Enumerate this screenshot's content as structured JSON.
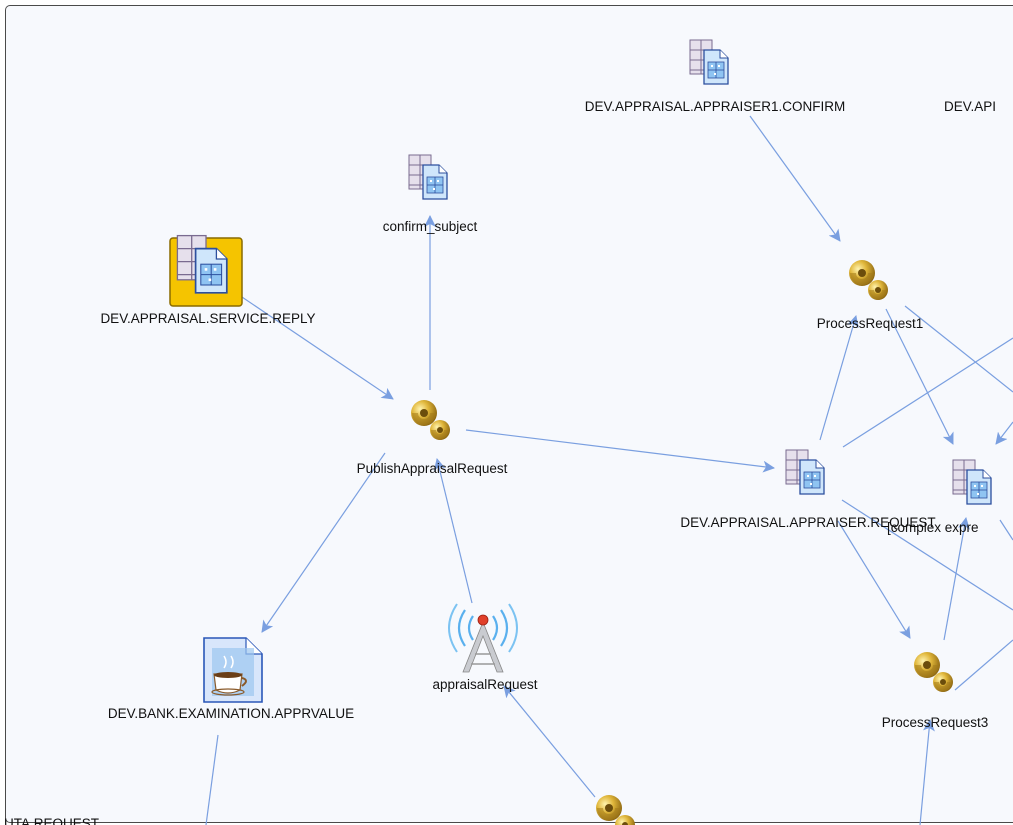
{
  "nodes": [
    {
      "id": "n_confirm",
      "type": "queue",
      "label": "DEV.APPRAISAL.APPRAISER1.CONFIRM",
      "selected": false
    },
    {
      "id": "n_partial",
      "type": "label-only",
      "label": "DEV.API",
      "selected": false
    },
    {
      "id": "n_subject",
      "type": "queue",
      "label": "confirm_subject",
      "selected": false
    },
    {
      "id": "n_reply",
      "type": "queue",
      "label": "DEV.APPRAISAL.SERVICE.REPLY",
      "selected": true
    },
    {
      "id": "n_pr1",
      "type": "process",
      "label": "ProcessRequest1",
      "selected": false
    },
    {
      "id": "n_publish",
      "type": "process",
      "label": "PublishAppraisalRequest",
      "selected": false
    },
    {
      "id": "n_request",
      "type": "queue",
      "label": "DEV.APPRAISAL.APPRAISER.REQUEST",
      "selected": false
    },
    {
      "id": "n_complex",
      "type": "queue",
      "label": "[complex expre",
      "selected": false
    },
    {
      "id": "n_bank",
      "type": "java",
      "label": "DEV.BANK.EXAMINATION.APPRVALUE",
      "selected": false
    },
    {
      "id": "n_antenna",
      "type": "broadcast",
      "label": "appraisalRequest",
      "selected": false
    },
    {
      "id": "n_pr3",
      "type": "process",
      "label": "ProcessRequest3",
      "selected": false
    },
    {
      "id": "n_bottom_left",
      "type": "label-only",
      "label": "UTA.REQUEST",
      "selected": false
    },
    {
      "id": "n_bottom_proc",
      "type": "process",
      "label": "",
      "selected": false
    }
  ],
  "edges": [
    {
      "id": "e1",
      "from": "n_reply",
      "to": "n_publish",
      "arrow": "end"
    },
    {
      "id": "e2",
      "from": "n_publish",
      "to": "n_subject",
      "arrow": "end"
    },
    {
      "id": "e3",
      "from": "n_publish",
      "to": "n_request",
      "arrow": "end"
    },
    {
      "id": "e4",
      "from": "n_publish",
      "to": "n_bank",
      "arrow": "end"
    },
    {
      "id": "e5",
      "from": "n_antenna",
      "to": "n_publish",
      "arrow": "end"
    },
    {
      "id": "e6",
      "from": "n_bottom_proc",
      "to": "n_antenna",
      "arrow": "end"
    },
    {
      "id": "e7",
      "from": "n_confirm",
      "to": "n_pr1",
      "arrow": "end"
    },
    {
      "id": "e8",
      "from": "n_request",
      "to": "n_pr1",
      "arrow": "end"
    },
    {
      "id": "e9",
      "from": "n_pr1",
      "to": "n_complex",
      "arrow": "end"
    },
    {
      "id": "e10",
      "from": "n_request",
      "to": "n_pr3",
      "arrow": "end"
    },
    {
      "id": "e11",
      "from": "n_pr3",
      "to": "n_complex",
      "arrow": "end"
    },
    {
      "id": "e12",
      "from": "n_bank",
      "to": "off-canvas-bottom",
      "arrow": "none"
    },
    {
      "id": "e13",
      "from": "off-canvas-bottom",
      "to": "n_pr3",
      "arrow": "end"
    },
    {
      "id": "e14",
      "from": "n_request",
      "to": "off-canvas-right",
      "arrow": "none"
    },
    {
      "id": "e15",
      "from": "n_pr1",
      "to": "off-canvas-right",
      "arrow": "none"
    },
    {
      "id": "e16",
      "from": "off-canvas-right",
      "to": "n_complex",
      "arrow": "end"
    },
    {
      "id": "e17",
      "from": "n_request",
      "to": "off-canvas-right",
      "arrow": "none"
    },
    {
      "id": "e18",
      "from": "n_pr3",
      "to": "off-canvas-right",
      "arrow": "none"
    },
    {
      "id": "e19",
      "from": "n_complex",
      "to": "off-canvas-bottom-right",
      "arrow": "none"
    }
  ],
  "colors": {
    "canvas": "#f7f9fd",
    "frame": "#4a4a4a",
    "edge": "#7a9fe0",
    "selection": "#f5c400",
    "label": "#111111"
  }
}
